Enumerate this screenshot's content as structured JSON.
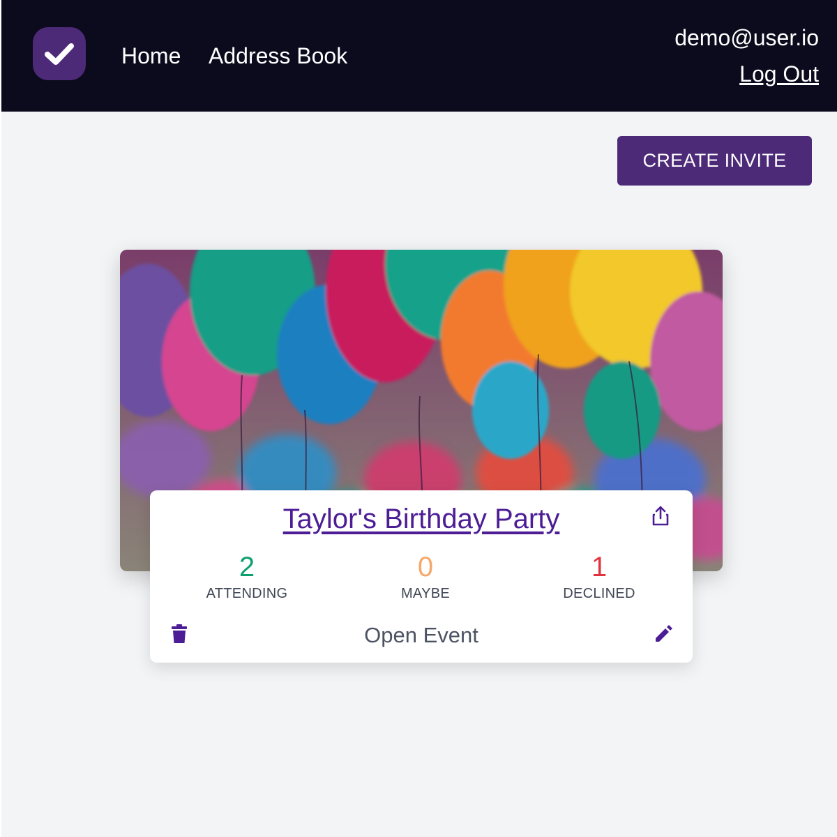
{
  "header": {
    "logo_icon": "checkmark-icon",
    "nav": [
      {
        "label": "Home"
      },
      {
        "label": "Address Book"
      }
    ],
    "user_email": "demo@user.io",
    "logout_label": "Log Out"
  },
  "actions": {
    "create_invite_label": "CREATE INVITE"
  },
  "event": {
    "image_subject": "balloons-photo",
    "title": "Taylor's Birthday Party",
    "share_icon": "share-icon",
    "stats": {
      "attending": {
        "count": "2",
        "label": "ATTENDING"
      },
      "maybe": {
        "count": "0",
        "label": "MAYBE"
      },
      "declined": {
        "count": "1",
        "label": "DECLINED"
      }
    },
    "open_label": "Open Event",
    "delete_icon": "trash-icon",
    "edit_icon": "pencil-icon"
  },
  "colors": {
    "brand": "#4c2a78",
    "topbar": "#0c0a1d",
    "attending": "#0e9f6e",
    "maybe": "#f6a868",
    "declined": "#e0333d"
  }
}
